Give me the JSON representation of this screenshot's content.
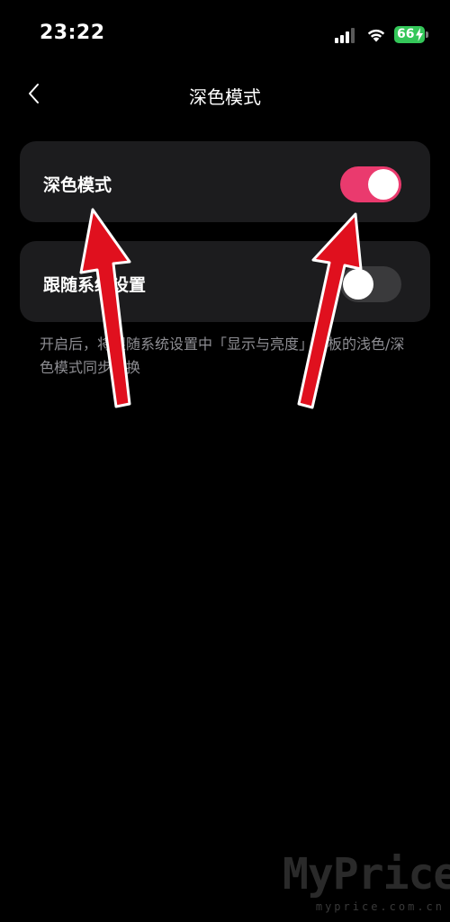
{
  "status_bar": {
    "time": "23:22",
    "battery_level": "66",
    "icons": [
      "signal-icon",
      "wifi-icon",
      "battery-icon",
      "charging-bolt-icon"
    ]
  },
  "header": {
    "title": "深色模式",
    "back_icon": "chevron-left-icon"
  },
  "settings": [
    {
      "label": "深色模式",
      "enabled": true
    },
    {
      "label": "跟随系统设置",
      "enabled": false
    }
  ],
  "description": "开启后，将跟随系统设置中「显示与亮度」面板的浅色/深色模式同步切换",
  "watermark": {
    "brand": "MyPrice",
    "domain": "myprice.com.cn"
  },
  "annotations": {
    "arrow_color": "#e0101e",
    "count": 2
  },
  "colors": {
    "toggle_on": "#ea3a6e",
    "toggle_off": "#3a3a3c",
    "card_bg": "#1c1c1e",
    "battery_green": "#34c759"
  }
}
